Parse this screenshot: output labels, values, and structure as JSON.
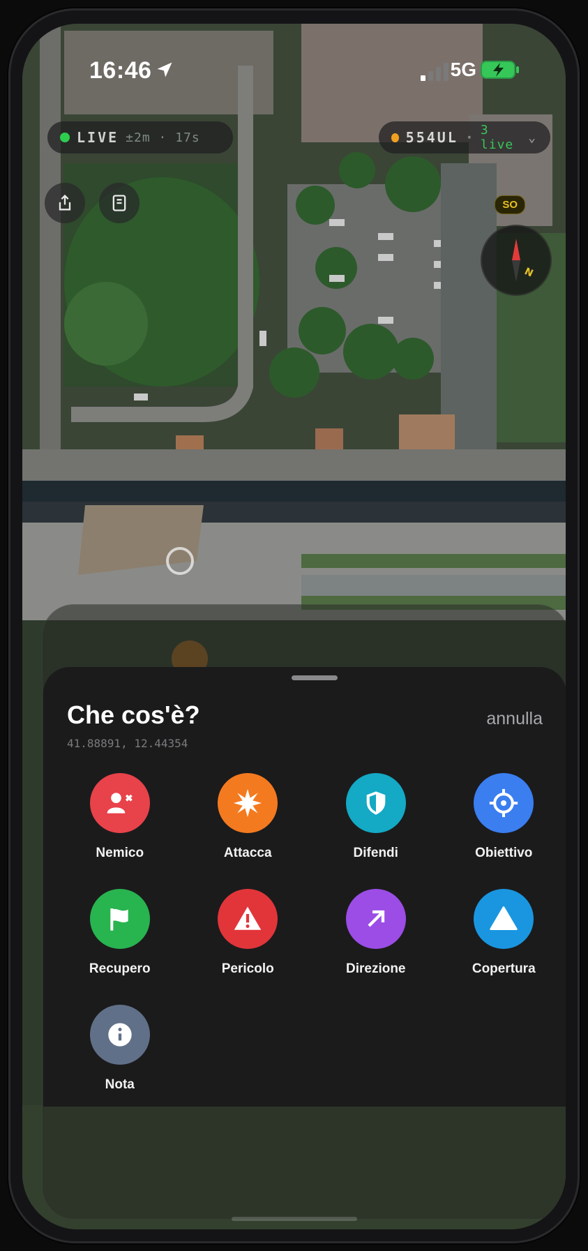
{
  "status_bar": {
    "time": "16:46",
    "network": "5G"
  },
  "top_bar": {
    "live_label": "LIVE",
    "live_sub": "±2m · 17s",
    "team_code": "554UL",
    "team_sep": "·",
    "team_live": "3 live"
  },
  "map": {
    "compass_badge": "SO"
  },
  "sheet": {
    "title": "Che cos'è?",
    "coordinates": "41.88891, 12.44354",
    "cancel_label": "annulla",
    "items": [
      {
        "label": "Nemico",
        "color": "#e8424a",
        "icon": "enemy-icon"
      },
      {
        "label": "Attacca",
        "color": "#f47a1f",
        "icon": "attack-icon"
      },
      {
        "label": "Difendi",
        "color": "#14a9c4",
        "icon": "shield-icon"
      },
      {
        "label": "Obiettivo",
        "color": "#3a7ef0",
        "icon": "target-icon"
      },
      {
        "label": "Recupero",
        "color": "#28b44f",
        "icon": "flag-icon"
      },
      {
        "label": "Pericolo",
        "color": "#e2353a",
        "icon": "warning-icon"
      },
      {
        "label": "Direzione",
        "color": "#9b4de6",
        "icon": "direction-arrow-icon"
      },
      {
        "label": "Copertura",
        "color": "#1a96e0",
        "icon": "cover-triangle-icon"
      },
      {
        "label": "Nota",
        "color": "#607088",
        "icon": "info-icon"
      }
    ]
  }
}
